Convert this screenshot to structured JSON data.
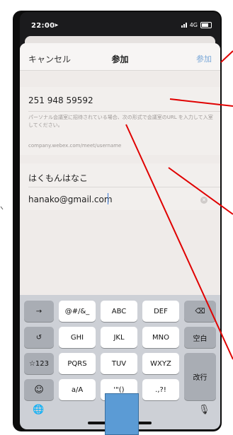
{
  "status_bar": {
    "time": "22:00",
    "network": "4G"
  },
  "nav": {
    "cancel": "キャンセル",
    "title": "参加",
    "join": "参加"
  },
  "meeting": {
    "number": "251 948 59592",
    "hint": "パーソナル会議室に招待されている場合、次の形式で会議室のURL を入力して入室してください。",
    "url_format": "company.webex.com/meet/username"
  },
  "user": {
    "name": "はくもんはなこ",
    "email": "hanako@gmail.com"
  },
  "keyboard": {
    "row1": [
      "→",
      "@#/&_",
      "ABC",
      "DEF",
      "⌫"
    ],
    "row2": [
      "↺",
      "GHI",
      "JKL",
      "MNO",
      "空白"
    ],
    "row3": [
      "☆123",
      "PQRS",
      "TUV",
      "WXYZ"
    ],
    "row4": [
      "☺",
      "a/A",
      "'\"()",
      ".,?!"
    ],
    "return": "改行"
  },
  "colors": {
    "arrow": "#e00000",
    "overlay": "#5b9bd5",
    "link": "#7aa8d8"
  }
}
